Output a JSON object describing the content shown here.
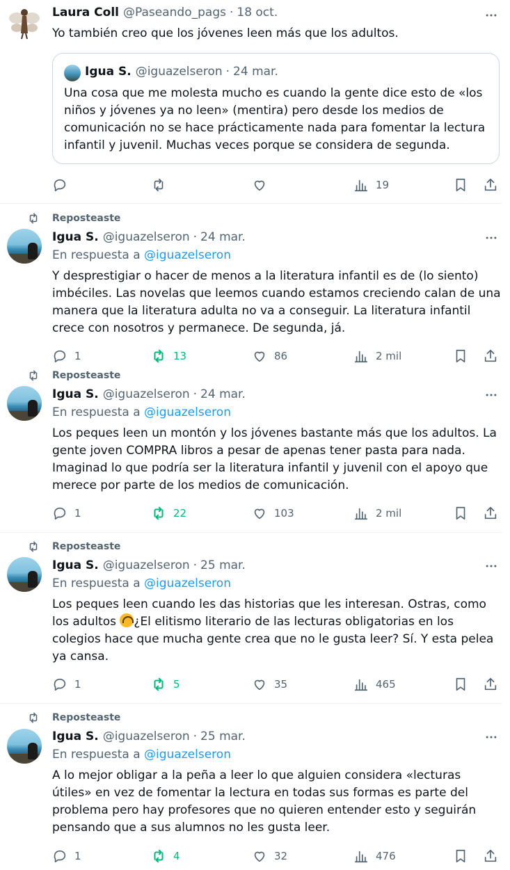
{
  "tweets": [
    {
      "id": "t0",
      "reposted": "",
      "name": "Laura Coll",
      "handle": "@Paseando_pags",
      "date": "18 oct.",
      "reply_prefix": "",
      "reply_handle": "",
      "text": "Yo también creo que los jóvenes leen más que los adultos.",
      "quote": {
        "name": "Igua S.",
        "handle": "@iguazelseron",
        "date": "24 mar.",
        "text": "Una cosa que me molesta mucho es cuando la gente dice esto de «los niños y jóvenes ya no leen» (mentira) pero desde los medios de comunicación no se hace prácticamente nada para fomentar la lectura infantil y juvenil. Muchas veces porque se considera de segunda."
      },
      "replies": "",
      "reposts": "",
      "likes": "",
      "views": "19"
    },
    {
      "id": "t1",
      "reposted": "Reposteaste",
      "name": "Igua S.",
      "handle": "@iguazelseron",
      "date": "24 mar.",
      "reply_prefix": "En respuesta a",
      "reply_handle": "@iguazelseron",
      "text": "Y desprestigiar o hacer de menos a la literatura infantil es de (lo siento) imbéciles. Las novelas que leemos cuando estamos creciendo calan de una manera que la literatura adulta no va a conseguir. La literatura infantil crece con nosotros y permanece. De segunda, já.",
      "replies": "1",
      "reposts": "13",
      "likes": "86",
      "views": "2 mil"
    },
    {
      "id": "t2",
      "reposted": "Reposteaste",
      "name": "Igua S.",
      "handle": "@iguazelseron",
      "date": "24 mar.",
      "reply_prefix": "En respuesta a",
      "reply_handle": "@iguazelseron",
      "text": "Los peques leen un montón y los jóvenes bastante más que los adultos. La gente joven COMPRA libros a pesar de apenas tener pasta para nada. Imaginad lo que podría ser la literatura infantil y juvenil con el apoyo que merece por parte de los medios de comunicación.",
      "replies": "1",
      "reposts": "22",
      "likes": "103",
      "views": "2 mil"
    },
    {
      "id": "t3",
      "reposted": "Reposteaste",
      "name": "Igua S.",
      "handle": "@iguazelseron",
      "date": "25 mar.",
      "reply_prefix": "En respuesta a",
      "reply_handle": "@iguazelseron",
      "text_part1": "Los peques leen cuando les das historias que les interesan. Ostras, como los adultos ",
      "emoji_icon": "upside-down-face-emoji",
      "text_part2": "¿El elitismo literario de las lecturas obligatorias en los colegios hace que mucha gente crea que no le gusta leer? Sí. Y esta pelea ya cansa.",
      "replies": "1",
      "reposts": "5",
      "likes": "35",
      "views": "465"
    },
    {
      "id": "t4",
      "reposted": "Reposteaste",
      "name": "Igua S.",
      "handle": "@iguazelseron",
      "date": "25 mar.",
      "reply_prefix": "En respuesta a",
      "reply_handle": "@iguazelseron",
      "text": "A lo mejor obligar a la peña a leer lo que alguien considera «lecturas útiles» en vez de fomentar la lectura en todas sus formas es parte del problema pero hay profesores que no quieren entender esto y seguirán pensando que a sus alumnos no les gusta leer.",
      "replies": "1",
      "reposts": "4",
      "likes": "32",
      "views": "476"
    }
  ],
  "colors": {
    "text": "#0f1419",
    "muted": "#536471",
    "link": "#1d9bf0",
    "repost_green": "#00ba7c",
    "divider": "#eff3f4"
  },
  "icons": [
    "more-icon",
    "reply-icon",
    "repost-icon",
    "like-icon",
    "views-icon",
    "bookmark-icon",
    "share-icon"
  ]
}
